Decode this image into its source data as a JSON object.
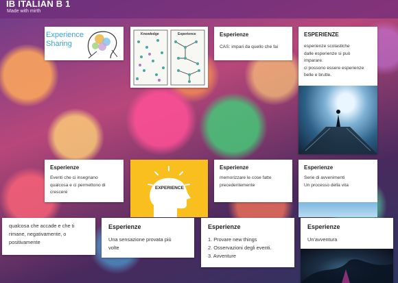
{
  "header": {
    "title": "IB ITALIAN B 1",
    "subtitle": "Made with mirth"
  },
  "cards": {
    "exp_sharing": {
      "logo_text_1": "Experience",
      "logo_text_2": "Sharing"
    },
    "knowledge_experience": {
      "left_label": "Knowledge",
      "right_label": "Experience"
    },
    "cas": {
      "title": "Esperienze",
      "body": "CAS: impari da quello che fai"
    },
    "scolastiche": {
      "title": "ESPERIENZE",
      "line1": "esperienze scolastiche",
      "line2": "dalle esperienze si può",
      "line3": "imparare.",
      "line4": "ci possono essere esperienze",
      "line5": "belle e brutte."
    },
    "eventi": {
      "title": "Esperienze",
      "line1": "Eventi che ci insegnano",
      "line2": "qualcosa e ci permettono di",
      "line3": "crescere"
    },
    "experience_head": {
      "label": "EXPERIENCE"
    },
    "memorizzare": {
      "title": "Esperienze",
      "line1": "memorizzare le cose fatte",
      "line2": "precedentemente"
    },
    "serie": {
      "title": "Esperienze",
      "line1": "Serie di avvenimenti",
      "line2": "Un processo della vita"
    },
    "qualcosa": {
      "line1": "qualcosa che accade e che ti",
      "line2": "rimane, negativamente, o",
      "line3": "positivamente"
    },
    "sensazione": {
      "title": "Esperienze",
      "line1": "Una sensazione provata più",
      "line2": "volte"
    },
    "provare": {
      "title": "Esperienze",
      "item1": "1. Provare new things",
      "item2": "2. Osservazioni degli eventi.",
      "item3": "3. Avventure"
    },
    "avventura": {
      "title": "Esperienze",
      "body": "Un'avventura"
    }
  }
}
